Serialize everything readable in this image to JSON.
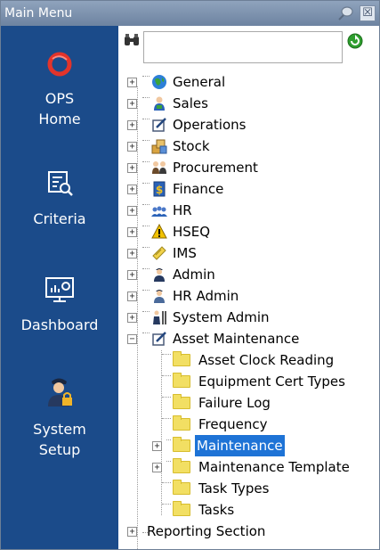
{
  "window": {
    "title": "Main Menu",
    "close_glyph": "☒"
  },
  "sidebar": {
    "items": [
      {
        "label": "OPS\nHome",
        "icon": "ops-logo-icon"
      },
      {
        "label": "Criteria",
        "icon": "criteria-search-icon"
      },
      {
        "label": "Dashboard",
        "icon": "dashboard-chart-icon"
      },
      {
        "label": "System\nSetup",
        "icon": "admin-user-lock-icon"
      }
    ],
    "background": "#1b4b8a"
  },
  "search": {
    "value": "",
    "placeholder": ""
  },
  "tree": {
    "items": [
      {
        "label": "General",
        "expander": "+"
      },
      {
        "label": "Sales",
        "expander": "+"
      },
      {
        "label": "Operations",
        "expander": "+"
      },
      {
        "label": "Stock",
        "expander": "+"
      },
      {
        "label": "Procurement",
        "expander": "+"
      },
      {
        "label": "Finance",
        "expander": "+"
      },
      {
        "label": "HR",
        "expander": "+"
      },
      {
        "label": "HSEQ",
        "expander": "+"
      },
      {
        "label": "IMS",
        "expander": "+"
      },
      {
        "label": "Admin",
        "expander": "+"
      },
      {
        "label": "HR Admin",
        "expander": "+"
      },
      {
        "label": "System Admin",
        "expander": "+"
      },
      {
        "label": "Asset Maintenance",
        "expander": "−"
      }
    ],
    "children": [
      {
        "label": "Asset Clock Reading"
      },
      {
        "label": "Equipment Cert Types"
      },
      {
        "label": "Failure Log"
      },
      {
        "label": "Frequency"
      },
      {
        "label": "Maintenance",
        "expander": "+",
        "selected": true
      },
      {
        "label": "Maintenance Template",
        "expander": "+"
      },
      {
        "label": "Task Types"
      },
      {
        "label": "Tasks"
      }
    ],
    "reporting": {
      "label": "Reporting Section",
      "expander": "+"
    },
    "selection_color": "#1e73d6"
  }
}
